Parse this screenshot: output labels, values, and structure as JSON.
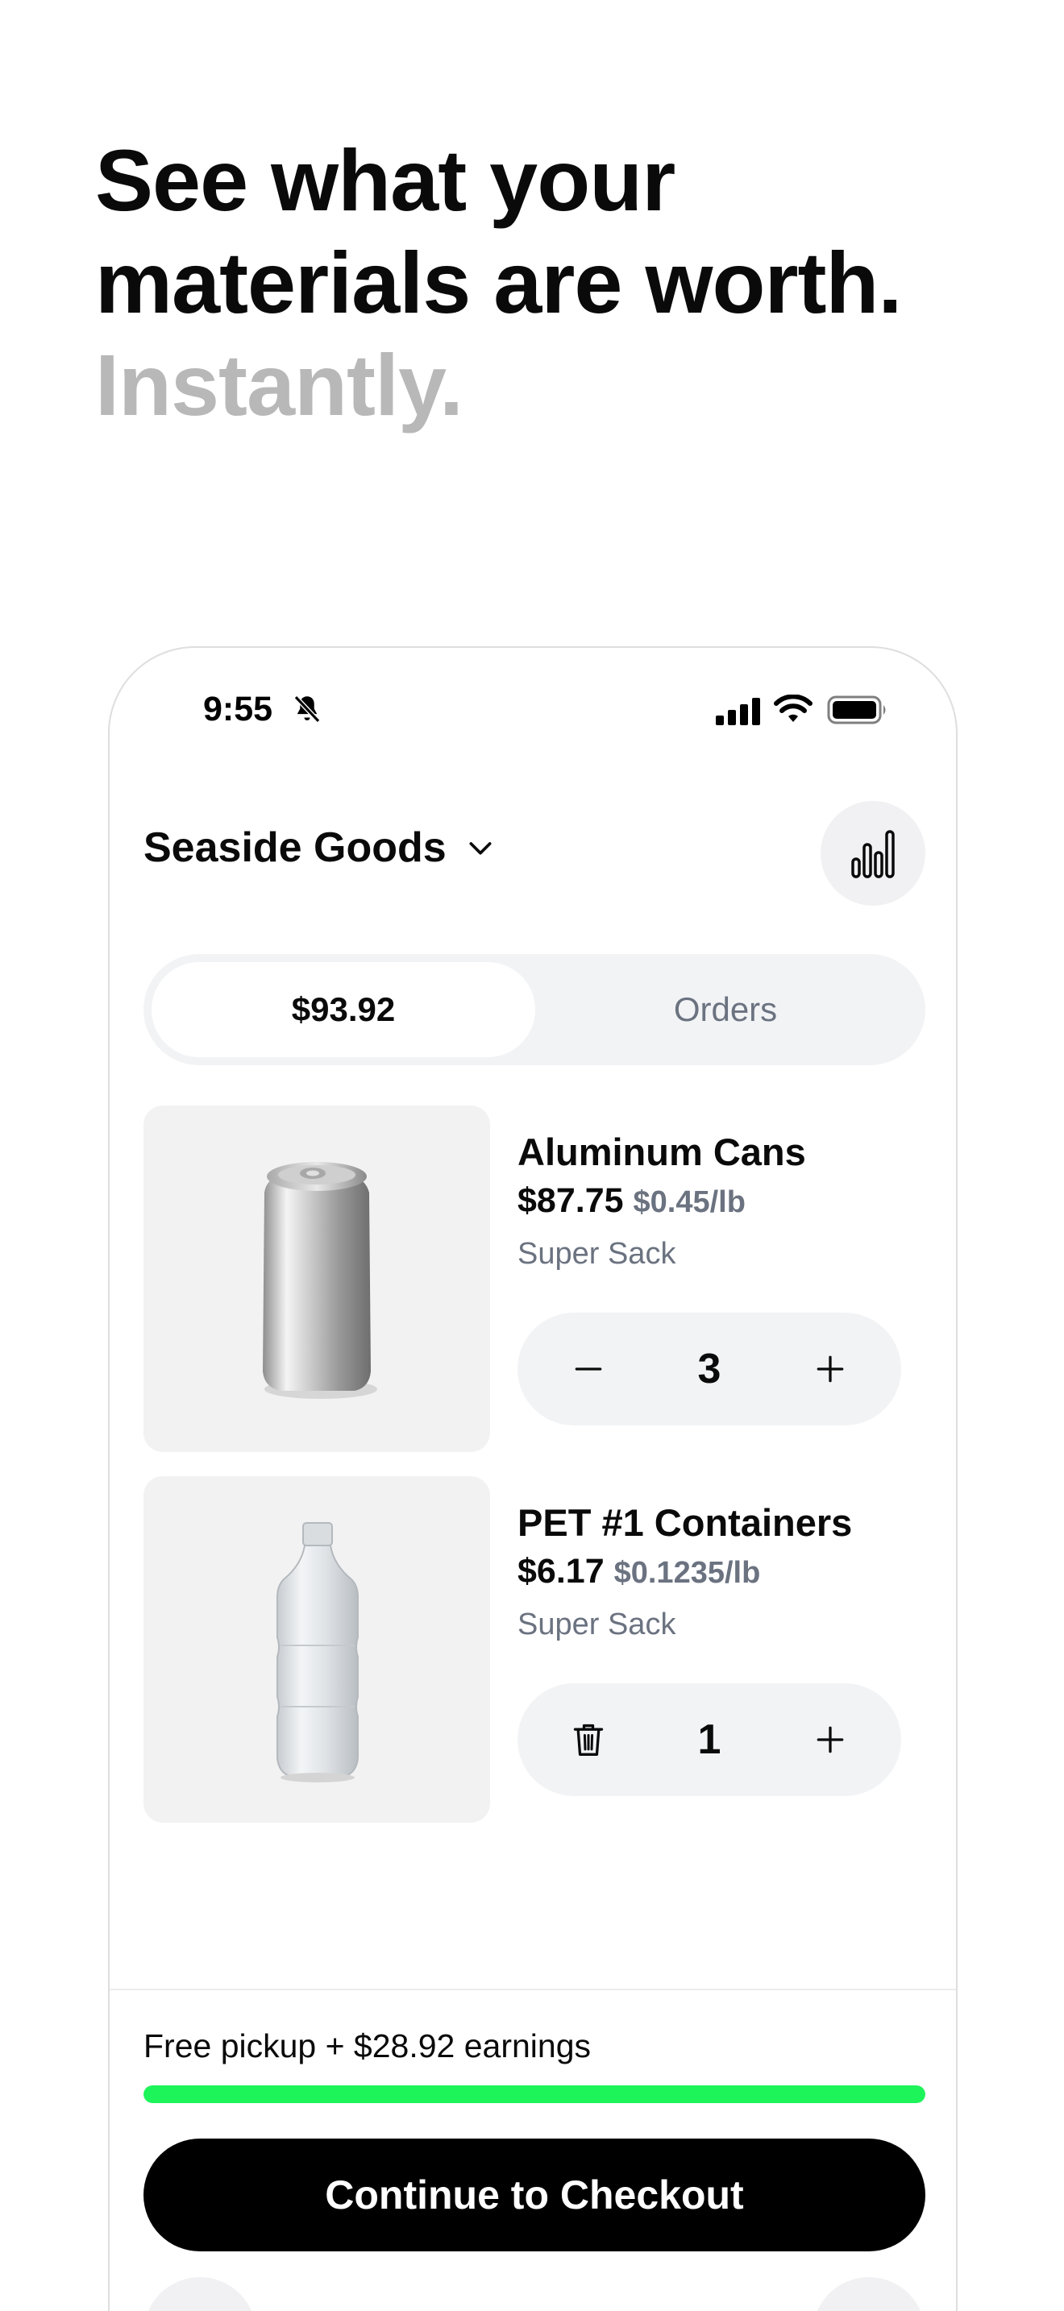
{
  "headline": {
    "line1": "See what your",
    "line2": "materials are worth.",
    "line3": "Instantly."
  },
  "status_bar": {
    "time": "9:55",
    "icons": [
      "bell-slash-icon",
      "cellular-signal-icon",
      "wifi-icon",
      "battery-icon"
    ]
  },
  "store": {
    "name": "Seaside Goods",
    "dropdown_icon": "chevron-down-icon",
    "stats_icon": "bar-chart-icon"
  },
  "tabs": [
    {
      "label": "$93.92",
      "active": true
    },
    {
      "label": "Orders",
      "active": false
    }
  ],
  "items": [
    {
      "name": "Aluminum Cans",
      "price": "$87.75",
      "unit_price": "$0.45/lb",
      "container": "Super Sack",
      "quantity": "3",
      "decrement_icon": "minus-icon",
      "increment_icon": "plus-icon"
    },
    {
      "name": "PET #1 Containers",
      "price": "$6.17",
      "unit_price": "$0.1235/lb",
      "container": "Super Sack",
      "quantity": "1",
      "decrement_icon": "trash-icon",
      "increment_icon": "plus-icon"
    }
  ],
  "footer": {
    "pickup_text": "Free pickup + $28.92 earnings",
    "progress_fraction": 1.0,
    "checkout_label": "Continue to Checkout"
  },
  "colors": {
    "accent_green": "#1df45a",
    "muted_text": "#6b7280",
    "headline_muted": "#b8b8b8",
    "surface": "#f2f3f5",
    "primary_button": "#000000"
  }
}
